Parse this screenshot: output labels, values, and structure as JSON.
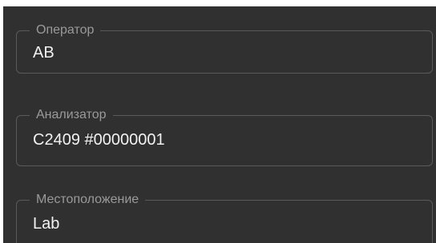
{
  "fields": [
    {
      "label": "Оператор",
      "value": "AB"
    },
    {
      "label": "Анализатор",
      "value": "C2409 #00000001"
    },
    {
      "label": "Местоположение",
      "value": "Lab"
    }
  ]
}
